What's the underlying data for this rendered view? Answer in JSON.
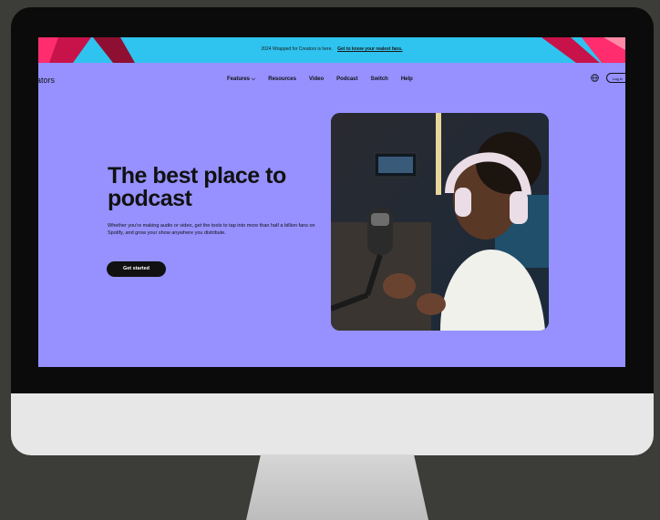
{
  "banner": {
    "text": "2024 Wrapped for Creators is here.",
    "link": "Get to know your realest fans."
  },
  "nav": {
    "brand": "ators",
    "items": [
      "Features ⌵",
      "Resources",
      "Video",
      "Podcast",
      "Switch",
      "Help"
    ],
    "login": "Log in"
  },
  "hero": {
    "title": "The best place to podcast",
    "subtitle": "Whether you're making audio or video, get the tools to tap into more than half a billion fans on Spotify, and grow your show anywhere you distribute.",
    "cta": "Get started"
  },
  "colors": {
    "page_bg": "#9691ff",
    "banner_bg": "#2fc3ef",
    "accent_pink": "#ff2c6e",
    "cta_bg": "#111111",
    "monitor_bezel": "#0b0b0b",
    "backdrop": "#3c3d38"
  },
  "icons": [
    "globe-icon",
    "chevron-down-icon"
  ]
}
